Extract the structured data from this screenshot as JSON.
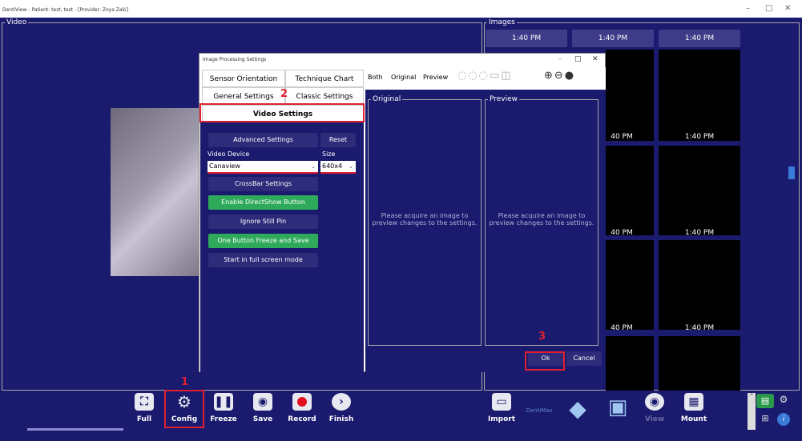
{
  "window": {
    "title": "DentiView - Patient: test, test - [Provider: Zoya Zaki]",
    "minimize": "–",
    "maximize": "□",
    "close": "✕"
  },
  "video": {
    "label": "Video"
  },
  "images": {
    "label": "Images",
    "times": [
      "1:40 PM",
      "1:40 PM",
      "1:40 PM",
      "40 PM",
      "1:40 PM",
      "40 PM",
      "1:40 PM",
      "40 PM",
      "1:40 PM"
    ]
  },
  "toolbar": {
    "full": "Full",
    "config": "Config",
    "freeze": "Freeze",
    "save": "Save",
    "record": "Record",
    "finish": "Finish",
    "import": "Import",
    "brand": "DentiMax",
    "view": "View",
    "mount": "Mount"
  },
  "dialog": {
    "title": "Image Processing Settings",
    "tabs": {
      "sensor": "Sensor Orientation",
      "technique": "Technique Chart",
      "general": "General Settings",
      "classic": "Classic Settings",
      "video": "Video Settings"
    },
    "advanced": "Advanced Settings",
    "reset": "Reset",
    "video_device_label": "Video Device",
    "size_label": "Size",
    "video_device_value": "Canaview",
    "size_value": "640x4",
    "crossbar": "CrossBar Settings",
    "directshow": "Enable DirectShow Button",
    "ignore": "Ignore Still Pin",
    "onebutton": "One Button Freeze and Save",
    "fullscreen": "Start in full screen mode",
    "view_tabs": {
      "both": "Both",
      "original": "Original",
      "preview": "Preview"
    },
    "original_label": "Original",
    "preview_label": "Preview",
    "acquire_msg": "Please acquire an image to preview changes to the settings.",
    "ok": "Ok",
    "cancel": "Cancel",
    "minimize": "–",
    "maximize": "□",
    "close": "✕"
  },
  "annotations": {
    "step1": "1",
    "step2": "2",
    "step3": "3"
  }
}
